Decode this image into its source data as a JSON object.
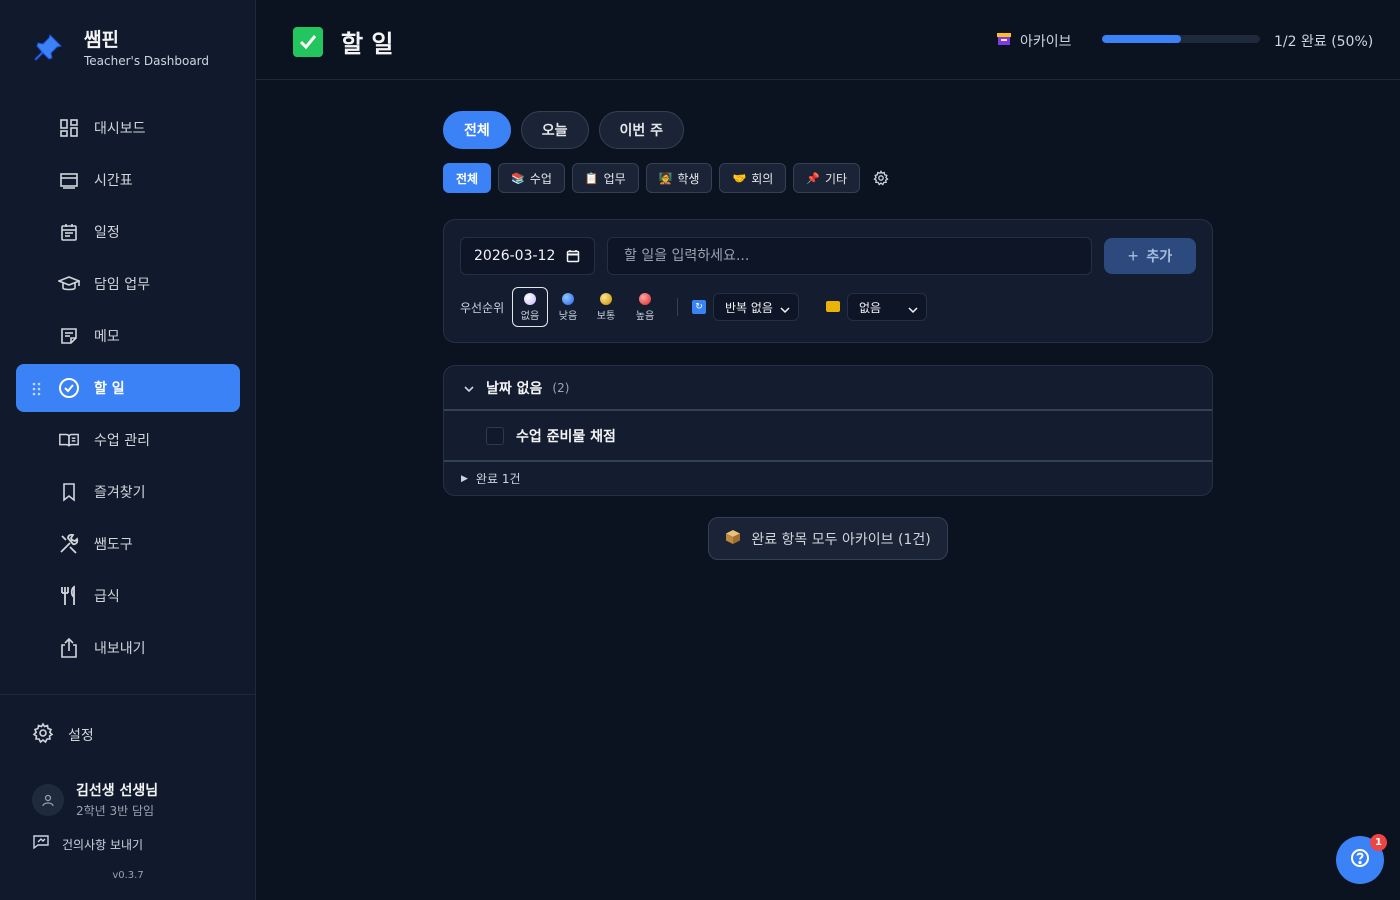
{
  "brand": {
    "title": "쌤핀",
    "subtitle": "Teacher's Dashboard"
  },
  "sidebar": {
    "items": [
      {
        "label": "대시보드",
        "icon": "dashboard-icon"
      },
      {
        "label": "시간표",
        "icon": "timetable-icon"
      },
      {
        "label": "일정",
        "icon": "calendar-icon"
      },
      {
        "label": "담임 업무",
        "icon": "graduation-cap-icon"
      },
      {
        "label": "메모",
        "icon": "memo-icon"
      },
      {
        "label": "할 일",
        "icon": "check-circle-icon",
        "active": true
      },
      {
        "label": "수업 관리",
        "icon": "book-icon"
      },
      {
        "label": "즐겨찾기",
        "icon": "bookmark-icon"
      },
      {
        "label": "쌤도구",
        "icon": "tools-icon"
      },
      {
        "label": "급식",
        "icon": "utensils-icon"
      },
      {
        "label": "내보내기",
        "icon": "share-icon"
      }
    ],
    "settings_label": "설정",
    "user": {
      "name": "김선생 선생님",
      "role": "2학년 3반 담임"
    },
    "feedback_label": "건의사항 보내기",
    "version": "v0.3.7"
  },
  "header": {
    "title": "할 일",
    "archive_label": "아카이브",
    "progress_fraction": 0.5,
    "progress_text": "1/2 완료 (50%)"
  },
  "tabs": [
    {
      "label": "전체",
      "active": true
    },
    {
      "label": "오늘"
    },
    {
      "label": "이번 주"
    }
  ],
  "categories": [
    {
      "label": "전체",
      "emoji": "",
      "active": true
    },
    {
      "label": "수업",
      "emoji": "📚"
    },
    {
      "label": "업무",
      "emoji": "📋"
    },
    {
      "label": "학생",
      "emoji": "🧑‍🏫"
    },
    {
      "label": "회의",
      "emoji": "🤝"
    },
    {
      "label": "기타",
      "emoji": "📌"
    }
  ],
  "add_form": {
    "date_value": "2026-03-12",
    "task_placeholder": "할 일을 입력하세요...",
    "add_label": "추가",
    "priority_label": "우선순위",
    "priorities": [
      {
        "label": "없음",
        "color": "#e9d5ff",
        "selected": true
      },
      {
        "label": "낮음",
        "color": "#3b82f6"
      },
      {
        "label": "보통",
        "color": "#eab308"
      },
      {
        "label": "높음",
        "color": "#ef4444"
      }
    ],
    "repeat_value": "반복 없음",
    "category_value": "없음"
  },
  "group": {
    "title": "날짜 없음",
    "count": "(2)",
    "tasks": [
      {
        "text": "수업 준비물 채점",
        "done": false
      }
    ],
    "done_label": "완료 1건"
  },
  "archive_all_label": "완료 항목 모두 아카이브 (1건)",
  "help": {
    "badge": "1"
  },
  "colors": {
    "accent": "#3b82f6",
    "background": "#0b1220",
    "sidebar": "#111a2c"
  }
}
